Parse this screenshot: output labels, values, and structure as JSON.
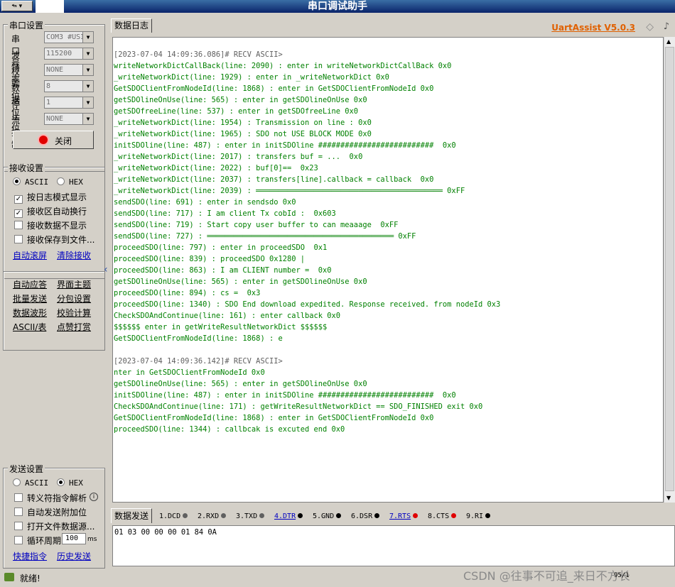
{
  "window": {
    "title": "串口调试助手",
    "system_menu_glyph": "🖘 ▾"
  },
  "serial_settings": {
    "title": "串口设置",
    "fields": [
      {
        "label": "串口号",
        "value": "COM3 #USI"
      },
      {
        "label": "波特率",
        "value": "115200"
      },
      {
        "label": "校验位",
        "value": "NONE"
      },
      {
        "label": "数据位",
        "value": "8"
      },
      {
        "label": "停止位",
        "value": "1"
      },
      {
        "label": "流控制",
        "value": "NONE"
      }
    ],
    "close_button_label": "关闭"
  },
  "receive_settings": {
    "title": "接收设置",
    "ascii_label": "ASCII",
    "hex_label": "HEX",
    "selected_mode": "ASCII",
    "options": [
      {
        "label": "按日志模式显示",
        "checked": true
      },
      {
        "label": "接收区自动换行",
        "checked": true
      },
      {
        "label": "接收数据不显示",
        "checked": false
      },
      {
        "label": "接收保存到文件...",
        "checked": false
      }
    ],
    "links": [
      "自动滚屏",
      "清除接收"
    ]
  },
  "tools": {
    "links": [
      [
        "自动应答",
        "界面主题"
      ],
      [
        "批量发送",
        "分包设置"
      ],
      [
        "数据波形",
        "校验计算"
      ],
      [
        "ASCII/表",
        "点赞打赏"
      ]
    ]
  },
  "send_settings": {
    "title": "发送设置",
    "ascii_label": "ASCII",
    "hex_label": "HEX",
    "selected_mode": "HEX",
    "options": [
      {
        "label": "转义符指令解析",
        "checked": false
      },
      {
        "label": "自动发送附加位",
        "checked": false
      },
      {
        "label": "打开文件数据源...",
        "checked": false
      }
    ],
    "loop": {
      "label": "循环周期",
      "value": "100",
      "unit": "ms",
      "checked": false
    },
    "links": [
      "快捷指令",
      "历史发送"
    ]
  },
  "receive_panel": {
    "tab": "数据日志",
    "brand": "UartAssist V5.0.3",
    "lines": [
      {
        "t": "",
        "c": "grn"
      },
      {
        "t": "[2023-07-04 14:09:36.086]# RECV ASCII>",
        "c": "hdr"
      },
      {
        "t": "writeNetworkDictCallBack(line: 2090) : enter in writeNetworkDictCallBack 0x0",
        "c": "grn"
      },
      {
        "t": "_writeNetworkDict(line: 1929) : enter in _writeNetworkDict 0x0",
        "c": "grn"
      },
      {
        "t": "GetSDOClientFromNodeId(line: 1868) : enter in GetSDOClientFromNodeId 0x0",
        "c": "grn"
      },
      {
        "t": "getSDOlineOnUse(line: 565) : enter in getSDOlineOnUse 0x0",
        "c": "grn"
      },
      {
        "t": "getSDOfreeLine(line: 537) : enter in getSDOfreeLine 0x0",
        "c": "grn"
      },
      {
        "t": "_writeNetworkDict(line: 1954) : Transmission on line : 0x0",
        "c": "grn"
      },
      {
        "t": "_writeNetworkDict(line: 1965) : SDO not USE BLOCK MODE 0x0",
        "c": "grn"
      },
      {
        "t": "initSDOline(line: 487) : enter in initSDOline ##########################  0x0",
        "c": "grn"
      },
      {
        "t": "_writeNetworkDict(line: 2017) : transfers buf = ...  0x0",
        "c": "grn"
      },
      {
        "t": "_writeNetworkDict(line: 2022) : buf[0]==  0x23",
        "c": "grn"
      },
      {
        "t": "_writeNetworkDict(line: 2037) : transfers[line].callback = callback  0x0",
        "c": "grn"
      },
      {
        "t": "_writeNetworkDict(line: 2039) : ══════════════════════════════════════════ 0xFF",
        "c": "grn"
      },
      {
        "t": "sendSDO(line: 691) : enter in sendsdo 0x0",
        "c": "grn"
      },
      {
        "t": "sendSDO(line: 717) : I am client Tx cobId :  0x603",
        "c": "grn"
      },
      {
        "t": "sendSDO(line: 719) : Start copy user buffer to can meaaage  0xFF",
        "c": "grn"
      },
      {
        "t": "sendSDO(line: 727) : ══════════════════════════════════════════ 0xFF",
        "c": "grn"
      },
      {
        "t": "proceedSDO(line: 797) : enter in proceedSDO  0x1",
        "c": "grn"
      },
      {
        "t": "proceedSDO(line: 839) : proceedSDO 0x1280 |",
        "c": "grn"
      },
      {
        "t": "proceedSDO(line: 863) : I am CLIENT number =  0x0",
        "c": "grn"
      },
      {
        "t": "getSDOlineOnUse(line: 565) : enter in getSDOlineOnUse 0x0",
        "c": "grn"
      },
      {
        "t": "proceedSDO(line: 894) : cs =  0x3",
        "c": "grn"
      },
      {
        "t": "proceedSDO(line: 1340) : SDO End download expedited. Response received. from nodeId 0x3",
        "c": "grn"
      },
      {
        "t": "CheckSDOAndContinue(line: 161) : enter callback 0x0",
        "c": "grn"
      },
      {
        "t": "$$$$$$ enter in getWriteResultNetworkDict $$$$$$",
        "c": "grn"
      },
      {
        "t": "GetSDOClientFromNodeId(line: 1868) : e",
        "c": "grn"
      },
      {
        "t": "",
        "c": "grn"
      },
      {
        "t": "[2023-07-04 14:09:36.142]# RECV ASCII>",
        "c": "hdr"
      },
      {
        "t": "nter in GetSDOClientFromNodeId 0x0",
        "c": "grn"
      },
      {
        "t": "getSDOlineOnUse(line: 565) : enter in getSDOlineOnUse 0x0",
        "c": "grn"
      },
      {
        "t": "initSDOline(line: 487) : enter in initSDOline ##########################  0x0",
        "c": "grn"
      },
      {
        "t": "CheckSDOAndContinue(line: 171) : getWriteResultNetworkDict == SDO_FINISHED exit 0x0",
        "c": "grn"
      },
      {
        "t": "GetSDOClientFromNodeId(line: 1868) : enter in GetSDOClientFromNodeId 0x0",
        "c": "grn"
      },
      {
        "t": "proceedSDO(line: 1344) : callbcak is excuted end 0x0",
        "c": "grn"
      }
    ]
  },
  "send_panel": {
    "tab": "数据发送",
    "signals": [
      {
        "label": "1.DCD",
        "state": "off",
        "active": false
      },
      {
        "label": "2.RXD",
        "state": "off",
        "active": false
      },
      {
        "label": "3.TXD",
        "state": "off",
        "active": false
      },
      {
        "label": "4.DTR",
        "state": "on",
        "active": true
      },
      {
        "label": "5.GND",
        "state": "on",
        "active": false
      },
      {
        "label": "6.DSR",
        "state": "on",
        "active": false
      },
      {
        "label": "7.RTS",
        "state": "red",
        "active": true
      },
      {
        "label": "8.CTS",
        "state": "red",
        "active": false
      },
      {
        "label": "9.RI",
        "state": "on",
        "active": false
      }
    ],
    "content": "01 03 00 00 00 01 84 0A"
  },
  "status": {
    "text": "就绪!",
    "counter": "95/1"
  },
  "watermark": "CSDN @往事不可追_来日不方长"
}
